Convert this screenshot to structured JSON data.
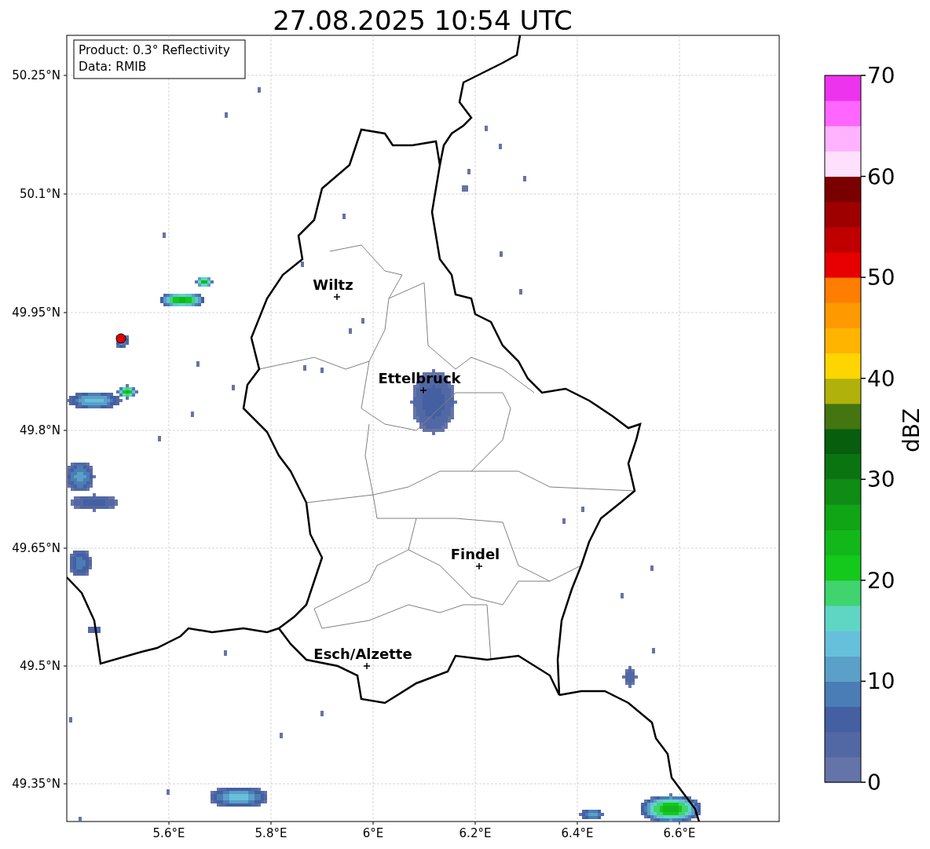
{
  "title": "27.08.2025 10:54 UTC",
  "info_box": [
    "Product: 0.3° Reflectivity",
    "Data: RMIB"
  ],
  "map": {
    "cities": [
      {
        "name": "Wiltz"
      },
      {
        "name": "Ettelbruck"
      },
      {
        "name": "Findel"
      },
      {
        "name": "Esch/Alzette"
      }
    ],
    "x_ticks": [
      "5.6°E",
      "5.8°E",
      "6°E",
      "6.2°E",
      "6.4°E",
      "6.6°E"
    ],
    "y_ticks": [
      "50.25°N",
      "50.1°N",
      "49.95°N",
      "49.8°N",
      "49.65°N",
      "49.5°N",
      "49.35°N"
    ]
  },
  "colorbar": {
    "label": "dBZ",
    "ticks": [
      "70",
      "60",
      "50",
      "40",
      "30",
      "20",
      "10",
      "0"
    ],
    "bins": [
      {
        "color": "#6574a8"
      },
      {
        "color": "#5268a4"
      },
      {
        "color": "#445fa2"
      },
      {
        "color": "#4a7db5"
      },
      {
        "color": "#5aa0c8"
      },
      {
        "color": "#66c0dc"
      },
      {
        "color": "#5fd6c4"
      },
      {
        "color": "#3fd46e"
      },
      {
        "color": "#14c81c"
      },
      {
        "color": "#12b81a"
      },
      {
        "color": "#10a514"
      },
      {
        "color": "#0e8c14"
      },
      {
        "color": "#0a7510"
      },
      {
        "color": "#075e0d"
      },
      {
        "color": "#437510"
      },
      {
        "color": "#b0b10a"
      },
      {
        "color": "#ffd500"
      },
      {
        "color": "#ffb400"
      },
      {
        "color": "#ff9900"
      },
      {
        "color": "#ff7d00"
      },
      {
        "color": "#e60000"
      },
      {
        "color": "#c00000"
      },
      {
        "color": "#9e0000"
      },
      {
        "color": "#7a0000"
      },
      {
        "color": "#ffe0fc"
      },
      {
        "color": "#ffb3ff"
      },
      {
        "color": "#ff66ff"
      },
      {
        "color": "#ee33ee"
      }
    ]
  }
}
